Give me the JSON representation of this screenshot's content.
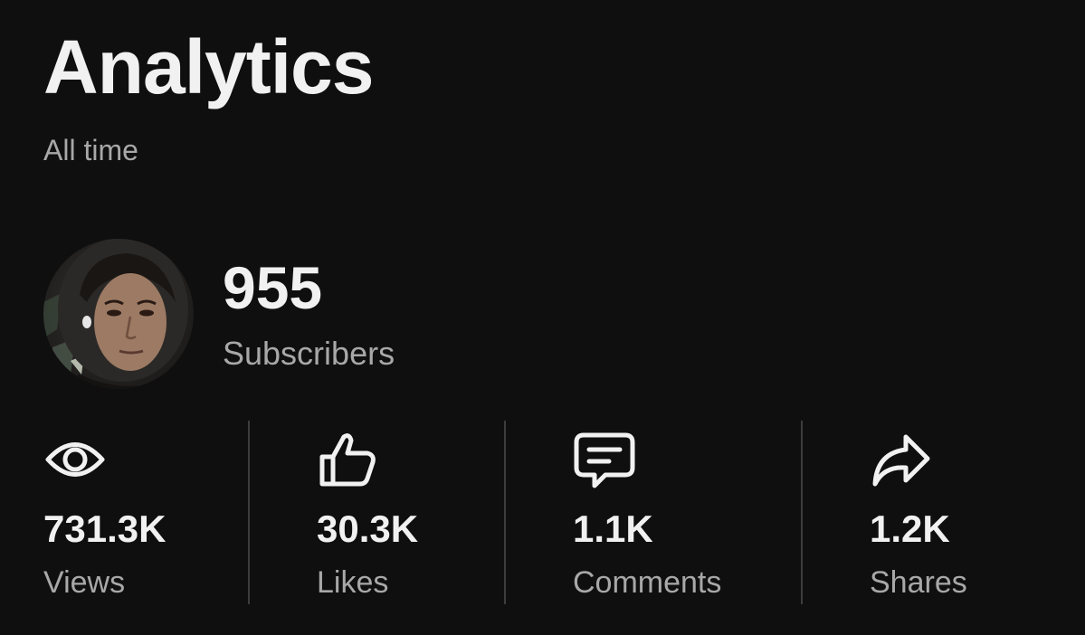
{
  "header": {
    "title": "Analytics",
    "period": "All time"
  },
  "channel": {
    "subscriber_count": "955",
    "subscriber_label": "Subscribers"
  },
  "stats": [
    {
      "icon": "eye-icon",
      "value": "731.3K",
      "label": "Views"
    },
    {
      "icon": "thumbs-up-icon",
      "value": "30.3K",
      "label": "Likes"
    },
    {
      "icon": "comment-icon",
      "value": "1.1K",
      "label": "Comments"
    },
    {
      "icon": "share-icon",
      "value": "1.2K",
      "label": "Shares"
    }
  ],
  "colors": {
    "background": "#0f0f0f",
    "primary_text": "#f1f1f1",
    "secondary_text": "#a8a8a8",
    "divider": "#3d3d3d"
  }
}
